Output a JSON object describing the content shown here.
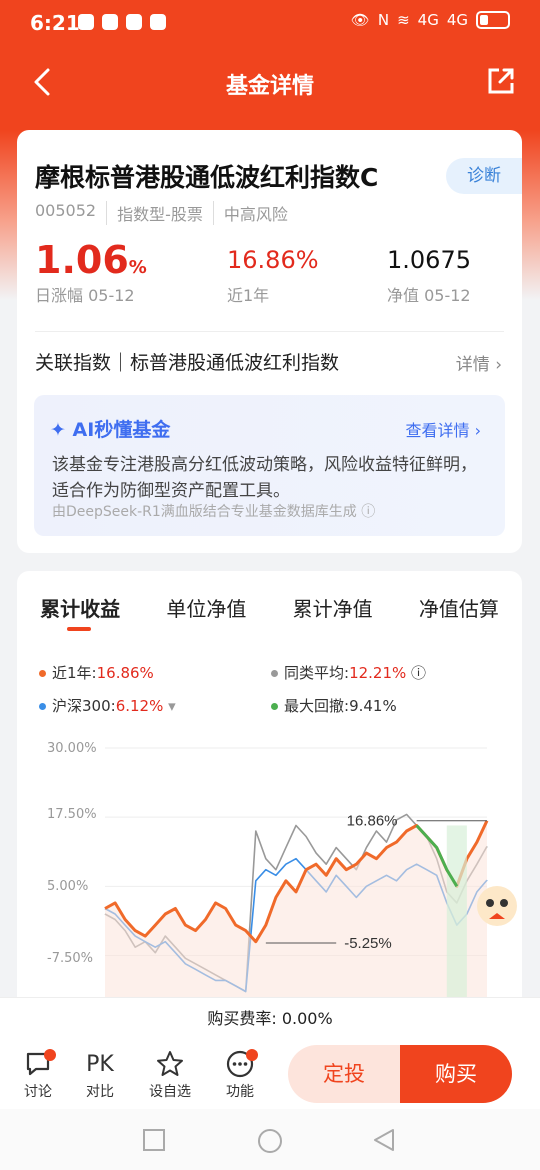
{
  "status": {
    "time": "6:21",
    "net1": "4G",
    "net2": "4G"
  },
  "nav": {
    "title": "基金详情"
  },
  "fund": {
    "name": "摩根标普港股通低波红利指数C",
    "diagnose": "诊断",
    "code": "005052",
    "type": "指数型-股票",
    "risk": "中高风险",
    "day_change": "1.06",
    "day_change_unit": "%",
    "day_change_label": "日涨幅 05-12",
    "year_return": "16.86%",
    "year_return_label": "近1年",
    "nav_value": "1.0675",
    "nav_label": "净值 05-12",
    "related_index": "关联指数｜标普港股通低波红利指数",
    "related_more": "详情"
  },
  "ai": {
    "title": "AI秒懂基金",
    "more": "查看详情",
    "text": "该基金专注港股高分红低波动策略，风险收益特征鲜明，适合作为防御型资产配置工具。",
    "source": "由DeepSeek-R1满血版结合专业基金数据库生成"
  },
  "tabs": [
    "累计收益",
    "单位净值",
    "累计净值",
    "净值估算"
  ],
  "legend": {
    "l1_label": "近1年:",
    "l1_value": "16.86%",
    "l2_label": "同类平均:",
    "l2_value": "12.21%",
    "l3_label": "沪深300:",
    "l3_value": "6.12%",
    "l4_label": "最大回撤:",
    "l4_value": "9.41%"
  },
  "colors": {
    "accent": "#f0441e",
    "fund": "#f06a2a",
    "peer": "#999999",
    "hs300": "#3a8ee6",
    "drawdown": "#4caf50"
  },
  "chart_data": {
    "type": "line",
    "ylabel_ticks": [
      "30.00%",
      "17.50%",
      "5.00%",
      "-7.50%"
    ],
    "ylim": [
      -15,
      30
    ],
    "annotations": [
      "16.86%",
      "-5.25%"
    ],
    "series": [
      {
        "name": "近1年",
        "values": [
          1,
          2,
          -1,
          -3,
          -4,
          -2,
          0,
          1,
          -2,
          -3,
          -1,
          2,
          1,
          -2,
          -3,
          -5,
          -2,
          3,
          6,
          4,
          8,
          9,
          7,
          10,
          8,
          9,
          11,
          10,
          12,
          13,
          15,
          16,
          14,
          12,
          8,
          5,
          10,
          13,
          16.86
        ]
      },
      {
        "name": "同类平均",
        "values": [
          0,
          -1,
          -3,
          -6,
          -5,
          -7,
          -4,
          -6,
          -8,
          -9,
          -10,
          -11,
          -12,
          -13,
          -14,
          15,
          10,
          8,
          12,
          16,
          14,
          11,
          9,
          12,
          10,
          8,
          12,
          15,
          13,
          17,
          18,
          16,
          14,
          10,
          4,
          2,
          6,
          9,
          12.21
        ]
      },
      {
        "name": "沪深300",
        "values": [
          1,
          0,
          -2,
          -4,
          -5,
          -6,
          -5,
          -7,
          -9,
          -10,
          -11,
          -12,
          -12,
          -13,
          -14,
          6,
          8,
          7,
          9,
          10,
          8,
          6,
          4,
          7,
          5,
          3,
          5,
          6,
          7,
          6,
          8,
          9,
          8,
          7,
          2,
          -2,
          0,
          4,
          6.12
        ]
      }
    ],
    "legend_position": "top"
  },
  "bottom": {
    "fee": "购买费率: 0.00%",
    "tools": [
      "讨论",
      "对比",
      "设自选",
      "功能"
    ],
    "pk": "PK",
    "dingtou": "定投",
    "buy": "购买"
  }
}
